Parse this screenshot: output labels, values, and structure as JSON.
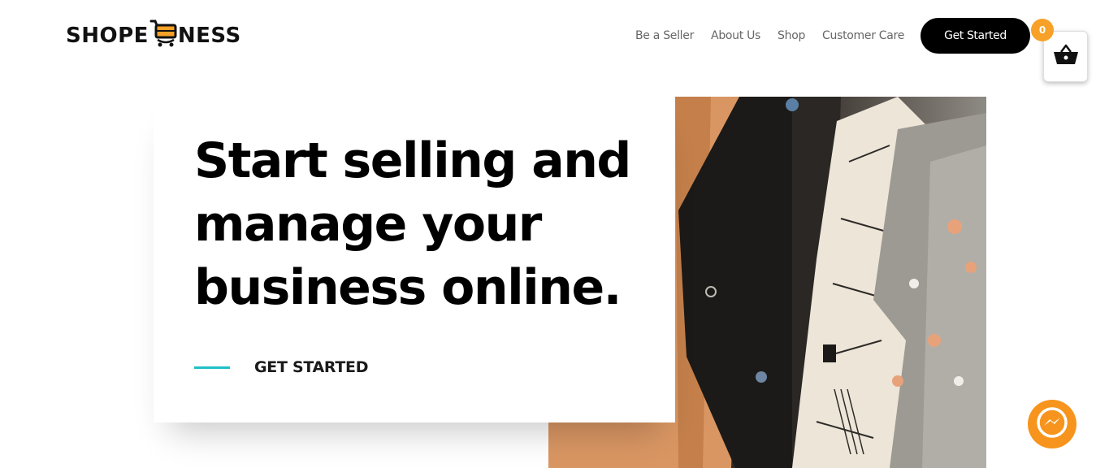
{
  "brand": {
    "name_left": "SHOPE",
    "name_right": "NESS",
    "logo_icon": "shopping-cart-icon"
  },
  "nav": {
    "items": [
      {
        "label": "Be a Seller"
      },
      {
        "label": "About Us"
      },
      {
        "label": "Shop"
      },
      {
        "label": "Customer Care"
      }
    ],
    "cta_label": "Get Started"
  },
  "cart": {
    "count": "0",
    "icon": "basket-icon",
    "badge_color": "#f7a128"
  },
  "hero": {
    "title": "Start selling and manage your business online.",
    "link_label": "GET STARTED",
    "accent_color": "#20c0c8",
    "image": "clothes-on-rack-photo"
  },
  "chat": {
    "icon": "messenger-icon",
    "color": "#f7941d"
  }
}
